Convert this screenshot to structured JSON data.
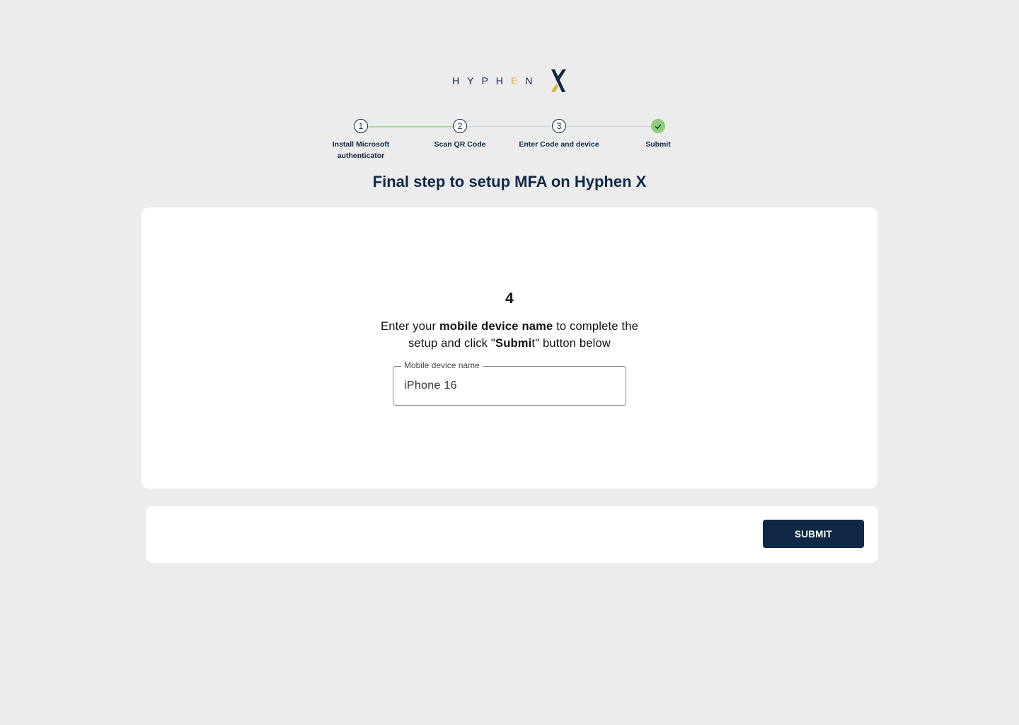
{
  "logo": {
    "text_prefix": "HYPH",
    "text_e": "E",
    "text_suffix": "N",
    "mark": "X"
  },
  "stepper": {
    "steps": [
      {
        "number": "1",
        "label_line1": "Install Microsoft",
        "label_line2": "authenticator"
      },
      {
        "number": "2",
        "label_line1": "Scan QR Code",
        "label_line2": ""
      },
      {
        "number": "3",
        "label_line1": "Enter Code and device",
        "label_line2": ""
      },
      {
        "number": "",
        "label_line1": "Submit",
        "label_line2": "",
        "icon": "check-icon"
      }
    ],
    "colors": {
      "done_line": "#a8d59a",
      "complete": "#8fcc7a"
    }
  },
  "page_title": "Final step to setup MFA on Hyphen X",
  "card": {
    "step_number": "4",
    "instruction": {
      "part1": "Enter your ",
      "bold1": "mobile device name",
      "part2": " to complete the setup and click \"",
      "bold2": "Submi",
      "part3": "t\" button below"
    },
    "field": {
      "label": "Mobile device name",
      "value": "iPhone 16"
    }
  },
  "footer": {
    "submit_label": "SUBMIT"
  },
  "colors": {
    "brand_navy": "#0f2846",
    "accent_gold": "#d9b43a",
    "background": "#ececec"
  }
}
